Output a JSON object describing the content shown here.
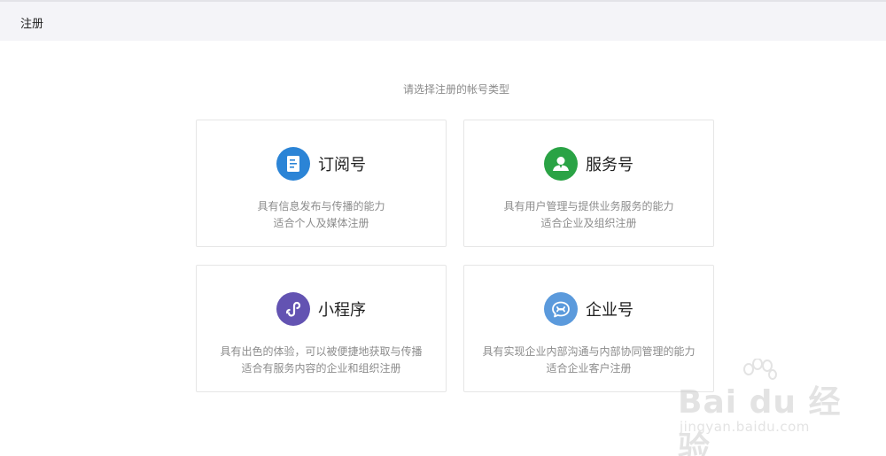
{
  "header": {
    "title": "注册"
  },
  "main": {
    "subtitle": "请选择注册的帐号类型",
    "cards": [
      {
        "title": "订阅号",
        "desc_line1": "具有信息发布与传播的能力",
        "desc_line2": "适合个人及媒体注册",
        "icon": "document-icon",
        "color": "#2b84d6"
      },
      {
        "title": "服务号",
        "desc_line1": "具有用户管理与提供业务服务的能力",
        "desc_line2": "适合企业及组织注册",
        "icon": "user-service-icon",
        "color": "#2aa345"
      },
      {
        "title": "小程序",
        "desc_line1": "具有出色的体验，可以被便捷地获取与传播",
        "desc_line2": "适合有服务内容的企业和组织注册",
        "icon": "mini-program-icon",
        "color": "#6353b2"
      },
      {
        "title": "企业号",
        "desc_line1": "具有实现企业内部沟通与内部协同管理的能力",
        "desc_line2": "适合企业客户注册",
        "icon": "enterprise-icon",
        "color": "#5b9adc"
      }
    ]
  },
  "watermark": {
    "text": "Bai du 经验",
    "sub": "jingyan.baidu.com"
  }
}
